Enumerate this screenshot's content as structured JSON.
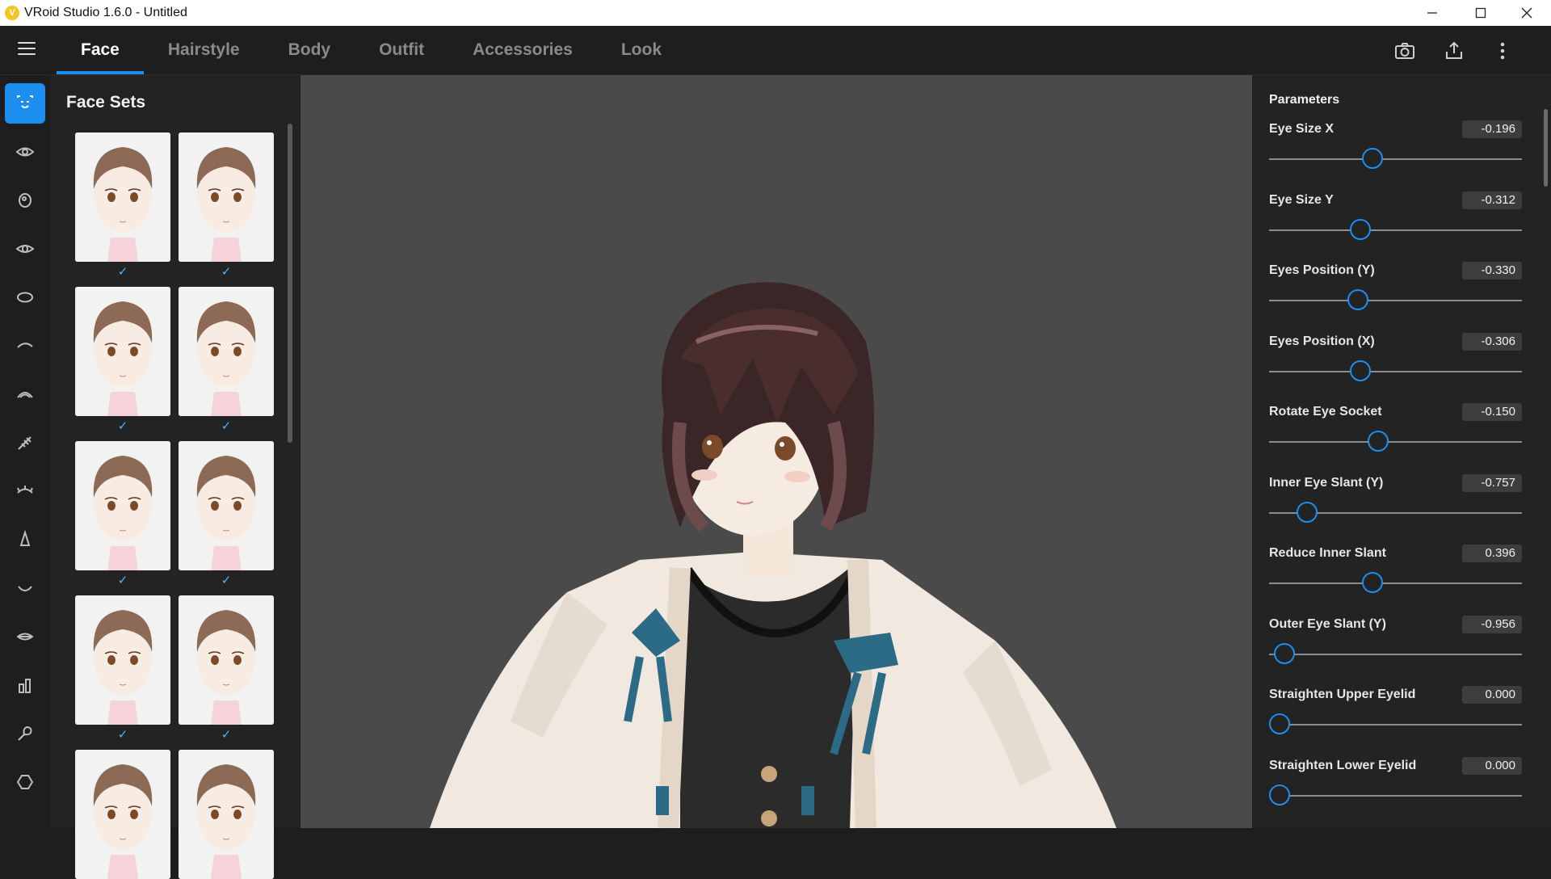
{
  "window": {
    "title": "VRoid Studio 1.6.0 - Untitled",
    "logo_glyph": "V"
  },
  "tabs": [
    {
      "label": "Face",
      "active": true
    },
    {
      "label": "Hairstyle",
      "active": false
    },
    {
      "label": "Body",
      "active": false
    },
    {
      "label": "Outfit",
      "active": false
    },
    {
      "label": "Accessories",
      "active": false
    },
    {
      "label": "Look",
      "active": false
    }
  ],
  "toolbar_icons": [
    "camera-icon",
    "share-icon",
    "more-vertical-icon"
  ],
  "rail_icons": [
    "face-icon",
    "eye-icon",
    "eyeball-icon",
    "eye-outline-icon",
    "eye-shape-icon",
    "eyebrow-icon",
    "eyelid-icon",
    "eyelash-icon",
    "eye-lower-icon",
    "nose-icon",
    "mouth-icon",
    "lips-icon",
    "teeth-icon",
    "ear-icon",
    "face-outline-icon"
  ],
  "face_sets": {
    "title": "Face Sets",
    "check_glyph": "✓",
    "count_visible": 10
  },
  "parameters": {
    "title": "Parameters",
    "items": [
      {
        "label": "Eye Size X",
        "value": "-0.196",
        "level": 0.41
      },
      {
        "label": "Eye Size Y",
        "value": "-0.312",
        "level": 0.36
      },
      {
        "label": "Eyes Position (Y)",
        "value": "-0.330",
        "level": 0.35
      },
      {
        "label": "Eyes Position (X)",
        "value": "-0.306",
        "level": 0.36
      },
      {
        "label": "Rotate Eye Socket",
        "value": "-0.150",
        "level": 0.43
      },
      {
        "label": "Inner Eye Slant (Y)",
        "value": "-0.757",
        "level": 0.15
      },
      {
        "label": "Reduce Inner Slant",
        "value": "0.396",
        "level": 0.41
      },
      {
        "label": "Outer Eye Slant (Y)",
        "value": "-0.956",
        "level": 0.06
      },
      {
        "label": "Straighten Upper Eyelid",
        "value": "0.000",
        "level": 0.0
      },
      {
        "label": "Straighten Lower Eyelid",
        "value": "0.000",
        "level": 0.0
      }
    ]
  },
  "colors": {
    "accent": "#1b8ef0",
    "check": "#4db1ff",
    "viewport_bg": "#4a4a4a"
  }
}
